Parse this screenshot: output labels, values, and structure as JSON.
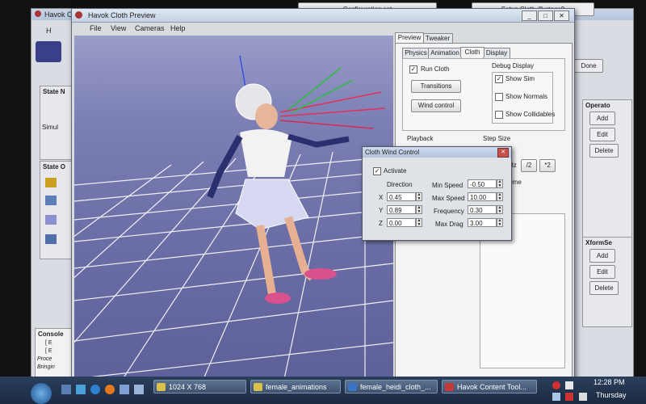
{
  "background_app": {
    "title": "Havok Cloth",
    "menu_h": "H",
    "config_label": "Configuration set",
    "setup_label": "Setup Cloth @ stage9",
    "done_label": "Done",
    "state_label": "State N",
    "simul_label": "Simul",
    "state2_label": "State O",
    "console_label": "Console",
    "console_lines": [
      "[ E",
      "[ E",
      "Proce",
      "Bringin"
    ],
    "operators_label": "Operato",
    "xform_label": "XformSe",
    "add_label": "Add",
    "edit_label": "Edit",
    "delete_label": "Delete"
  },
  "preview": {
    "title": "Havok Cloth Preview",
    "menu": [
      "File",
      "View",
      "Cameras",
      "Help"
    ],
    "tabs": [
      "Preview",
      "Tweaker"
    ],
    "subtabs": [
      "Physics",
      "Animation",
      "Cloth",
      "Display"
    ],
    "run_cloth": "Run Cloth",
    "transitions": "Transitions",
    "wind_control": "Wind control",
    "debug_display": "Debug Display",
    "show_sim": "Show Sim",
    "show_normals": "Show Normals",
    "show_collidables": "Show Collidables",
    "playback": "Playback",
    "step_size": "Step Size",
    "hz": "Hz",
    "half": "/2",
    "double": "*2",
    "realtime": "ealtime"
  },
  "wind_dialog": {
    "title": "Cloth Wind Control",
    "activate": "Activate",
    "direction": "Direction",
    "x_label": "X",
    "x_value": "0.45",
    "y_label": "Y",
    "y_value": "0.89",
    "z_label": "Z",
    "z_value": "0.00",
    "min_speed_label": "Min Speed",
    "min_speed": "-0.50",
    "max_speed_label": "Max Speed",
    "max_speed": "10.00",
    "frequency_label": "Frequency",
    "frequency": "0.30",
    "max_drag_label": "Max Drag",
    "max_drag": "3.00"
  },
  "taskbar": {
    "tasks": [
      "1024 X 768",
      "female_animations",
      "female_heidi_cloth_...",
      "Havok Content Tool..."
    ],
    "time": "12:28 PM",
    "day": "Thursday"
  }
}
